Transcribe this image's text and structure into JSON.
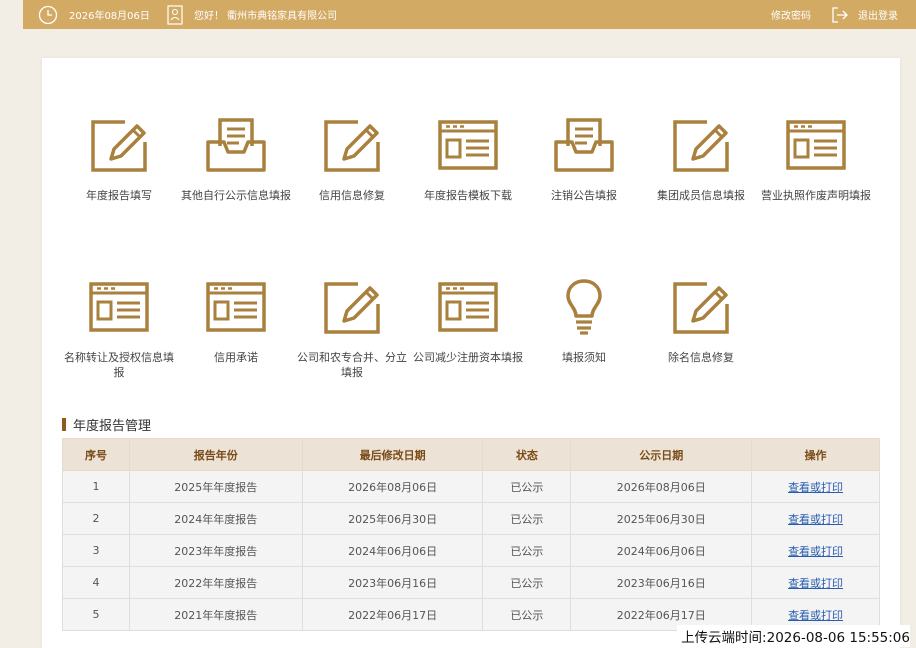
{
  "header": {
    "date": "2026年08月06日",
    "greeting": "您好！ 衢州市典铭家具有限公司",
    "change_password": "修改密码",
    "logout": "退出登录"
  },
  "tiles": [
    {
      "label": "年度报告填写",
      "icon": "pencil-board-icon"
    },
    {
      "label": "其他自行公示信息填报",
      "icon": "inbox-document-icon"
    },
    {
      "label": "信用信息修复",
      "icon": "pencil-board-icon"
    },
    {
      "label": "年度报告模板下载",
      "icon": "form-window-icon"
    },
    {
      "label": "注销公告填报",
      "icon": "inbox-document-icon"
    },
    {
      "label": "集团成员信息填报",
      "icon": "pencil-board-icon"
    },
    {
      "label": "营业执照作废声明填报",
      "icon": "form-window-icon"
    },
    {
      "label": "名称转让及授权信息填报",
      "icon": "form-window-icon"
    },
    {
      "label": "信用承诺",
      "icon": "form-window-icon"
    },
    {
      "label": "公司和农专合并、分立填报",
      "icon": "pencil-board-icon"
    },
    {
      "label": "公司减少注册资本填报",
      "icon": "form-window-icon"
    },
    {
      "label": "填报须知",
      "icon": "lightbulb-icon"
    },
    {
      "label": "除名信息修复",
      "icon": "pencil-board-icon"
    }
  ],
  "section": {
    "title": "年度报告管理"
  },
  "table": {
    "headers": [
      "序号",
      "报告年份",
      "最后修改日期",
      "状态",
      "公示日期",
      "操作"
    ],
    "rows": [
      {
        "no": "1",
        "year": "2025年年度报告",
        "modified": "2026年08月06日",
        "status": "已公示",
        "published": "2026年08月06日",
        "action": "查看或打印"
      },
      {
        "no": "2",
        "year": "2024年年度报告",
        "modified": "2025年06月30日",
        "status": "已公示",
        "published": "2025年06月30日",
        "action": "查看或打印"
      },
      {
        "no": "3",
        "year": "2023年年度报告",
        "modified": "2024年06月06日",
        "status": "已公示",
        "published": "2024年06月06日",
        "action": "查看或打印"
      },
      {
        "no": "4",
        "year": "2022年年度报告",
        "modified": "2023年06月16日",
        "status": "已公示",
        "published": "2023年06月16日",
        "action": "查看或打印"
      },
      {
        "no": "5",
        "year": "2021年年度报告",
        "modified": "2022年06月17日",
        "status": "已公示",
        "published": "2022年06月17日",
        "action": "查看或打印"
      }
    ]
  },
  "footer": {
    "upload_time": "上传云端时间:2026-08-06 15:55:06"
  },
  "colors": {
    "accent": "#d2aa64",
    "icon": "#a9803d",
    "header_text": "#7a4b18",
    "link": "#2a5db0"
  }
}
